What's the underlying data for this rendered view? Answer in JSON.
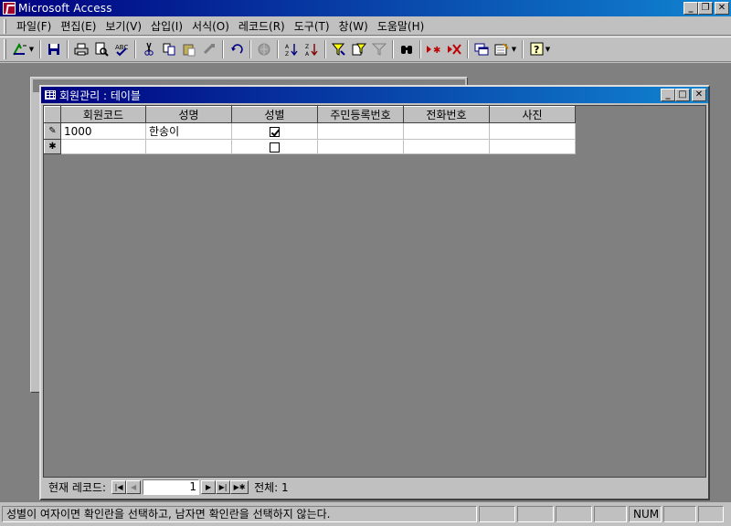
{
  "app": {
    "title": "Microsoft Access"
  },
  "caption_buttons": {
    "minimize": "_",
    "restore": "❐",
    "close": "✕"
  },
  "menu": [
    {
      "label": "파일(F)"
    },
    {
      "label": "편집(E)"
    },
    {
      "label": "보기(V)"
    },
    {
      "label": "삽입(I)"
    },
    {
      "label": "서식(O)"
    },
    {
      "label": "레코드(R)"
    },
    {
      "label": "도구(T)"
    },
    {
      "label": "창(W)"
    },
    {
      "label": "도움말(H)"
    }
  ],
  "toolbar_icons": [
    "view-icon",
    "save-icon",
    "print-icon",
    "print-preview-icon",
    "spelling-icon",
    "cut-icon",
    "copy-icon",
    "paste-icon",
    "format-painter-icon",
    "undo-icon",
    "insert-hyperlink-icon",
    "sort-ascending-icon",
    "sort-descending-icon",
    "filter-by-selection-icon",
    "filter-by-form-icon",
    "apply-filter-icon",
    "find-icon",
    "new-record-icon",
    "delete-record-icon",
    "database-window-icon",
    "new-object-icon",
    "help-icon"
  ],
  "table_window": {
    "title": "회원관리 : 테이블",
    "columns": [
      "회원코드",
      "성명",
      "성별",
      "주민등록번호",
      "전화번호",
      "사진"
    ],
    "rows": [
      {
        "selector": "✎",
        "member_code": "1000",
        "name": "한송이",
        "gender_checked": true,
        "ssn": "",
        "phone": "",
        "photo": ""
      },
      {
        "selector": "✱",
        "member_code": "",
        "name": "",
        "gender_checked": false,
        "ssn": "",
        "phone": "",
        "photo": ""
      }
    ]
  },
  "record_nav": {
    "label": "현재 레코드:",
    "current": "1",
    "total_label": "전체: 1",
    "first": "|◀",
    "prev": "◀",
    "next": "▶",
    "last": "▶|",
    "new": "▶✱"
  },
  "status": {
    "message": "성별이 여자이면 확인란을 선택하고, 남자면 확인란을 선택하지 않는다.",
    "num": "NUM"
  }
}
